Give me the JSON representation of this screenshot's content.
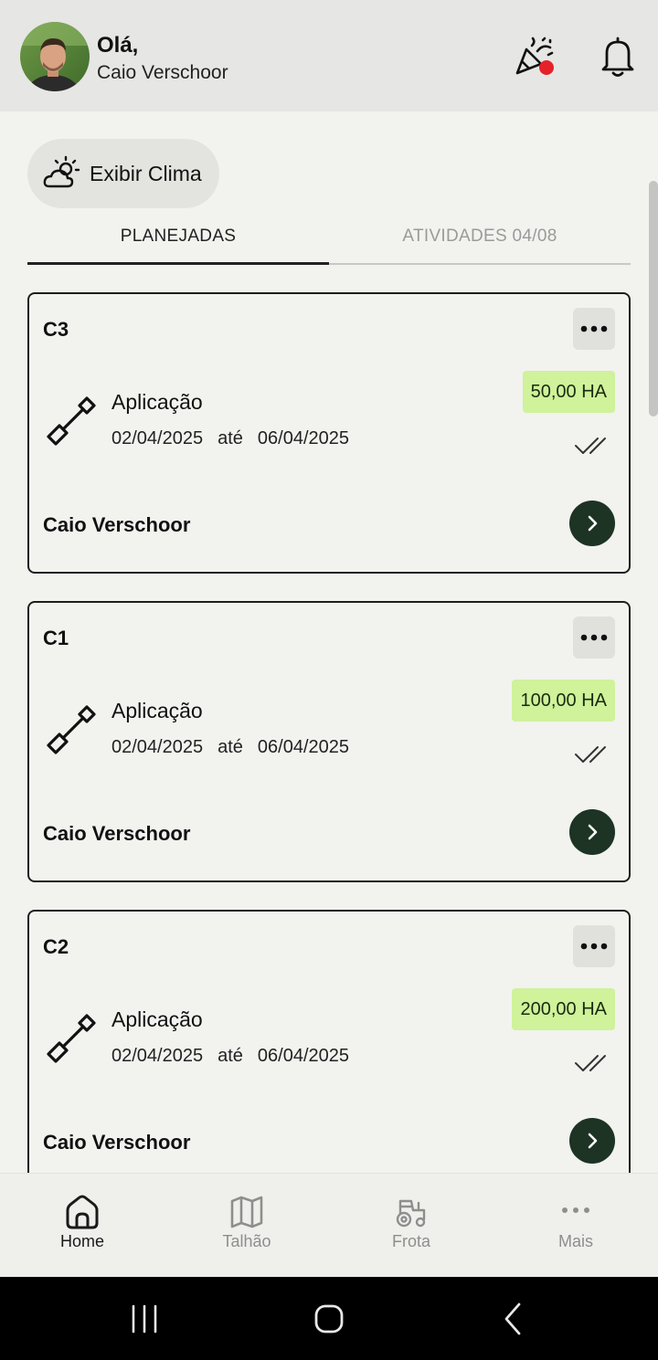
{
  "header": {
    "greeting": "Olá,",
    "username": "Caio Verschoor",
    "icons": [
      "avatar",
      "party-popper-icon",
      "bell-icon"
    ],
    "notification_dot_color": "#e5222a"
  },
  "weather_button": {
    "label": "Exibir Clima",
    "icon": "sun-cloud-icon"
  },
  "tabs": [
    {
      "label": "PLANEJADAS",
      "active": true
    },
    {
      "label": "ATIVIDADES 04/08",
      "active": false
    }
  ],
  "cards": [
    {
      "title": "C3",
      "activity": "Aplicação",
      "start": "02/04/2025",
      "until": "até",
      "end": "06/04/2025",
      "area": "50,00 HA",
      "owner": "Caio Verschoor"
    },
    {
      "title": "C1",
      "activity": "Aplicação",
      "start": "02/04/2025",
      "until": "até",
      "end": "06/04/2025",
      "area": "100,00 HA",
      "owner": "Caio Verschoor"
    },
    {
      "title": "C2",
      "activity": "Aplicação",
      "start": "02/04/2025",
      "until": "até",
      "end": "06/04/2025",
      "area": "200,00 HA",
      "owner": "Caio Verschoor"
    }
  ],
  "colors": {
    "area_badge": "#cff29a",
    "go_button": "#1d3324",
    "background": "#f2f2ef"
  },
  "bottom_nav": [
    {
      "label": "Home",
      "icon": "home-icon",
      "active": true
    },
    {
      "label": "Talhão",
      "icon": "map-icon",
      "active": false
    },
    {
      "label": "Frota",
      "icon": "tractor-icon",
      "active": false
    },
    {
      "label": "Mais",
      "icon": "more-icon",
      "active": false
    }
  ],
  "system_nav": [
    "recent-apps-icon",
    "home-circle-icon",
    "back-icon"
  ]
}
